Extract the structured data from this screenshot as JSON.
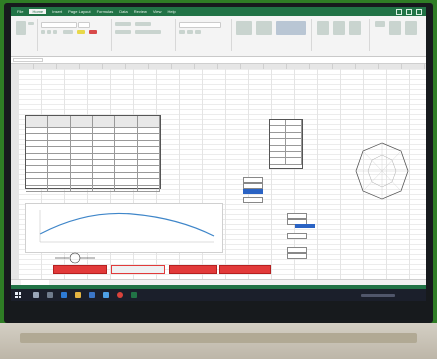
{
  "ribbon": {
    "tabs": [
      "File",
      "Home",
      "Insert",
      "Page Layout",
      "Formulas",
      "Data",
      "Review",
      "View",
      "Help"
    ],
    "active_tab": "Home"
  },
  "colors": {
    "excel_green": "#217346",
    "error_red": "#e23a3a",
    "selection_blue": "#2a63c4",
    "background_green": "#2f7d25"
  },
  "icons": [
    "undo-icon",
    "clipboard-icon",
    "bold-icon",
    "italic-icon",
    "align-icon",
    "wrap-icon",
    "merge-icon",
    "currency-icon",
    "conditional-format-icon",
    "table-format-icon",
    "cell-style-icon",
    "insert-icon",
    "delete-icon",
    "format-icon",
    "sum-icon",
    "sort-icon",
    "find-icon",
    "start-icon",
    "search-icon",
    "taskview-icon",
    "edge-icon",
    "explorer-icon",
    "store-icon",
    "mail-icon",
    "chrome-icon",
    "excel-icon"
  ]
}
